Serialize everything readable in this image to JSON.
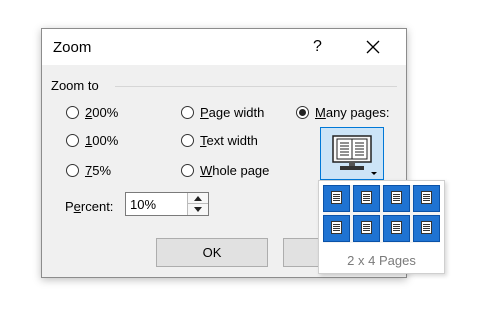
{
  "dialog": {
    "title": "Zoom",
    "help_label": "?",
    "group_label": "Zoom to",
    "options": {
      "z200_pre": "",
      "z200_acc": "2",
      "z200_post": "00%",
      "z100_pre": "",
      "z100_acc": "1",
      "z100_post": "00%",
      "z75_pre": "",
      "z75_acc": "7",
      "z75_post": "5%",
      "page_width_pre": "",
      "page_width_acc": "P",
      "page_width_post": "age width",
      "text_width_pre": "",
      "text_width_acc": "T",
      "text_width_post": "ext width",
      "whole_page_pre": "",
      "whole_page_acc": "W",
      "whole_page_post": "hole page",
      "many_pages_pre": "",
      "many_pages_acc": "M",
      "many_pages_post": "any pages:"
    },
    "selected_option": "many-pages",
    "percent": {
      "label_pre": "P",
      "label_acc": "e",
      "label_post": "rcent:",
      "value": "10%"
    },
    "ok_label": "OK",
    "many_pages_popup": {
      "rows": 2,
      "cols": 4,
      "label": "2 x 4 Pages"
    }
  },
  "colors": {
    "dialog_bg": "#f0f0f0",
    "accent": "#0078d7",
    "selected_cell": "#1f73d2",
    "popup_label": "#7a7a7a"
  },
  "icons": {
    "close": "close-icon",
    "monitor": "monitor-icon",
    "page_cell": "page-icon",
    "dropdown": "chevron-down-icon"
  }
}
